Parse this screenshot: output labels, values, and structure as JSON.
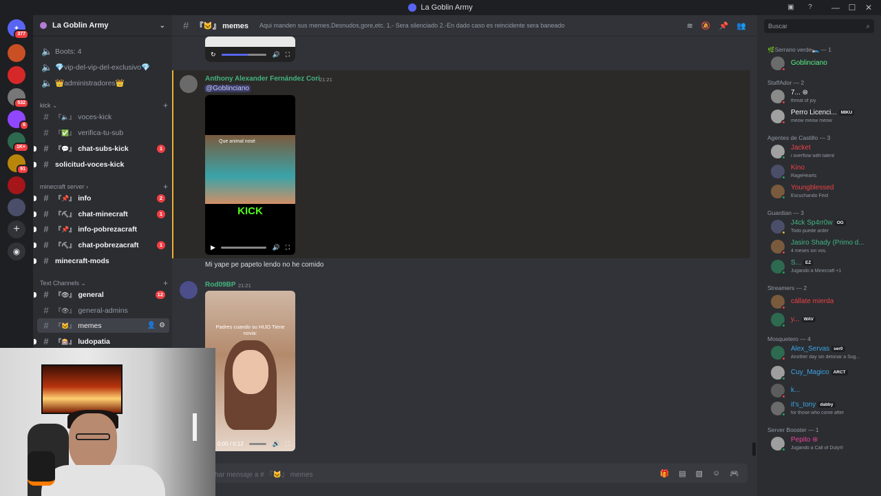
{
  "window": {
    "title": "La Goblin Army"
  },
  "servers": [
    {
      "icon": "discord-home-icon",
      "badge": "377"
    },
    {
      "icon": "server-icon",
      "badge": ""
    },
    {
      "icon": "server-icon",
      "badge": ""
    },
    {
      "icon": "server-icon",
      "badge": "532"
    },
    {
      "icon": "twitch-server-icon",
      "badge": "6"
    },
    {
      "icon": "server-icon",
      "badge": "1K+"
    },
    {
      "icon": "server-icon",
      "badge": "91"
    },
    {
      "icon": "server-icon",
      "badge": ""
    },
    {
      "icon": "server-icon",
      "badge": ""
    }
  ],
  "guild": {
    "name": "La Goblin Army",
    "voice_items": [
      {
        "label": "Boots: 4"
      },
      {
        "label": "💎vip-del-vip-del-exclusivo💎"
      },
      {
        "label": "👑administradores👑"
      }
    ],
    "categories": {
      "kick": "kick",
      "minecraft": "minecraft server",
      "text": "Text Channels"
    },
    "kick_channels": [
      {
        "emoji": "『🔈』",
        "label": "voces-kick",
        "badge": ""
      },
      {
        "emoji": "『✅』",
        "label": "verifica-tu-sub",
        "badge": ""
      },
      {
        "emoji": "『💬』",
        "label": "chat-subs-kick",
        "badge": "1"
      },
      {
        "emoji": "",
        "label": "solicitud-voces-kick",
        "badge": ""
      }
    ],
    "minecraft_channels": [
      {
        "emoji": "『📌』",
        "label": "info",
        "badge": "2"
      },
      {
        "emoji": "『⛏』",
        "label": "chat-minecraft",
        "badge": "1"
      },
      {
        "emoji": "『📌』",
        "label": "info-pobrezacraft",
        "badge": ""
      },
      {
        "emoji": "『⛏』",
        "label": "chat-pobrezacraft",
        "badge": "1"
      },
      {
        "emoji": "",
        "label": "minecraft-mods",
        "badge": ""
      }
    ],
    "text_channels": [
      {
        "emoji": "『👁』",
        "label": "general",
        "badge": "12"
      },
      {
        "emoji": "『👁』",
        "label": "general-admins",
        "badge": ""
      },
      {
        "emoji": "『🐱』",
        "label": "memes",
        "badge": ""
      },
      {
        "emoji": "『🎰』",
        "label": "ludopatia",
        "badge": ""
      }
    ]
  },
  "channel": {
    "name": "『🐱』 memes",
    "topic": "Aqui manden sus memes.Desnudos,gore,etc. 1.- Sera silenciado 2.-En dado caso es reincidente sera baneado"
  },
  "messages": [
    {
      "author": "Anthony Alexander Fernández Cori",
      "author_color": "#43b581",
      "time": "21:21",
      "mention": "@Goblinciano",
      "video_caption": "Que animal nosé",
      "video_brand": "KICK",
      "text": "Mi yape pe papeto lendo no he comido"
    },
    {
      "author": "Rod09BP",
      "author_color": "#43b581",
      "time": "21:21",
      "video_caption": "Padres cuando su HIJO Tiene novia:",
      "video_time": "0:00 / 0:12"
    }
  ],
  "composer": {
    "placeholder": "har mensaje a # 『🐱』 memes"
  },
  "search": {
    "placeholder": "Buscar"
  },
  "member_groups": [
    {
      "title": "🌿Serrano verde🛌 — 1",
      "members": [
        {
          "name": "Goblinciano",
          "color": "#57f287",
          "tag": "",
          "status": "",
          "presence": "#f23f43"
        }
      ]
    },
    {
      "title": "StaffAdor — 2",
      "members": [
        {
          "name": "7... ⊛",
          "color": "#f2f3f5",
          "tag": "",
          "status": "threat of joy",
          "presence": "#f23f43"
        },
        {
          "name": "Perro Licenci...",
          "color": "#f2f3f5",
          "tag": "MIKU",
          "status": "meow meow meow",
          "presence": "#f23f43"
        }
      ]
    },
    {
      "title": "Agentes de Castillo — 3",
      "members": [
        {
          "name": "Jacket",
          "color": "#ed4245",
          "tag": "",
          "status": "i overflow with talent",
          "presence": "#23a55a"
        },
        {
          "name": "Kino",
          "color": "#ed4245",
          "tag": "",
          "status": "RageHearts",
          "presence": "#23a55a"
        },
        {
          "name": "Youngblessed",
          "color": "#ed4245",
          "tag": "",
          "status": "Escuchando Feid",
          "presence": "#23a55a"
        }
      ]
    },
    {
      "title": "Guardian — 3",
      "members": [
        {
          "name": "J4ck Sp4rr0w",
          "color": "#43b581",
          "tag": "OG",
          "status": "Todo puede arder",
          "presence": "#f0b232"
        },
        {
          "name": "Jasiro Shady (Primo d...",
          "color": "#43b581",
          "tag": "",
          "status": "4 meses sin vos.",
          "presence": "#f23f43"
        },
        {
          "name": "S...",
          "color": "#43b581",
          "tag": "EZ",
          "status": "Jugando a Minecraft +1",
          "presence": "#23a55a"
        }
      ]
    },
    {
      "title": "Streamers — 2",
      "members": [
        {
          "name": "cállate mierda",
          "color": "#ed4245",
          "tag": "",
          "status": "",
          "presence": "#f23f43"
        },
        {
          "name": "y...",
          "color": "#ed4245",
          "tag": "WAV",
          "status": "",
          "presence": "#23a55a"
        }
      ]
    },
    {
      "title": "Mosquetero — 4",
      "members": [
        {
          "name": "Alex_Servas",
          "color": "#3ba5e6",
          "tag": "ser0",
          "status": "Another day sin detonar a Sug...",
          "presence": "#f23f43"
        },
        {
          "name": "Cuy_Magico",
          "color": "#3ba5e6",
          "tag": "ARCT",
          "status": "",
          "presence": "#23a55a"
        },
        {
          "name": "k...",
          "color": "#3ba5e6",
          "tag": "",
          "status": "",
          "presence": "#f23f43"
        },
        {
          "name": "it's_tony",
          "color": "#3ba5e6",
          "tag": "dabby",
          "status": "for those who come after",
          "presence": "#23a55a"
        }
      ]
    },
    {
      "title": "Server Booster — 1",
      "members": [
        {
          "name": "Pepito ⊛",
          "color": "#eb459f",
          "tag": "",
          "status": "Jugando a Call of Duty®",
          "presence": "#23a55a"
        }
      ]
    }
  ]
}
